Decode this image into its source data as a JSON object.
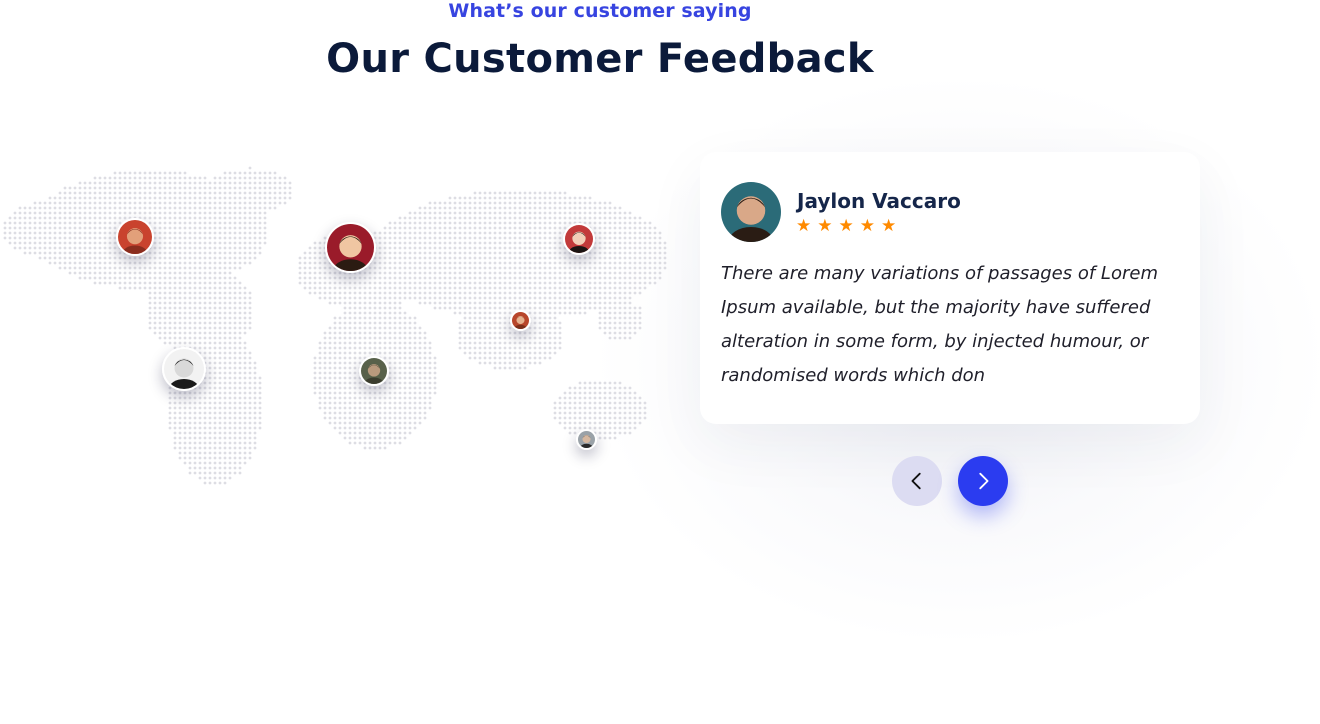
{
  "section": {
    "eyebrow": "What’s our customer saying",
    "title": "Our Customer Feedback"
  },
  "map": {
    "dot_color": "#dddde3",
    "pins": [
      {
        "name": "customer-pin-north-america",
        "skin": "#e2a07a",
        "hair": "#8a2d1e",
        "bg": "#c9432e"
      },
      {
        "name": "customer-pin-europe-north",
        "skin": "#f0c6a2",
        "hair": "#2b1b12",
        "bg": "#9a1b2a"
      },
      {
        "name": "customer-pin-russia",
        "skin": "#f2cfb8",
        "hair": "#1c1412",
        "bg": "#c23a3a"
      },
      {
        "name": "customer-pin-south-america",
        "skin": "#d9d9d9",
        "hair": "#1a1a1a",
        "bg": "#f2f2f2"
      },
      {
        "name": "customer-pin-africa",
        "skin": "#b99a7d",
        "hair": "#3b3d2e",
        "bg": "#58614a"
      },
      {
        "name": "customer-pin-asia",
        "skin": "#e6b28f",
        "hair": "#7b2f1a",
        "bg": "#b8462b"
      },
      {
        "name": "customer-pin-australia",
        "skin": "#d6b8a0",
        "hair": "#2a2a2a",
        "bg": "#9aa2a8"
      }
    ]
  },
  "testimonial": {
    "name": "Jaylon Vaccaro",
    "rating": 5,
    "stars": [
      "★",
      "★",
      "★",
      "★",
      "★"
    ],
    "quote": "There are many variations of passages of Lorem Ipsum available, but the majority have suffered alteration in some form, by injected humour, or randomised words which don",
    "avatar": {
      "skin": "#d9a888",
      "hair": "#2a1c14",
      "bg": "#2b6b78"
    }
  },
  "navigation": {
    "prev_icon": "chevron-left-icon",
    "next_icon": "chevron-right-icon"
  },
  "colors": {
    "accent": "#2b3cf0",
    "eyebrow": "#3744e0",
    "heading": "#0b1a3a",
    "star": "#ff8a00",
    "prev_button_bg": "#dcdcf2"
  }
}
